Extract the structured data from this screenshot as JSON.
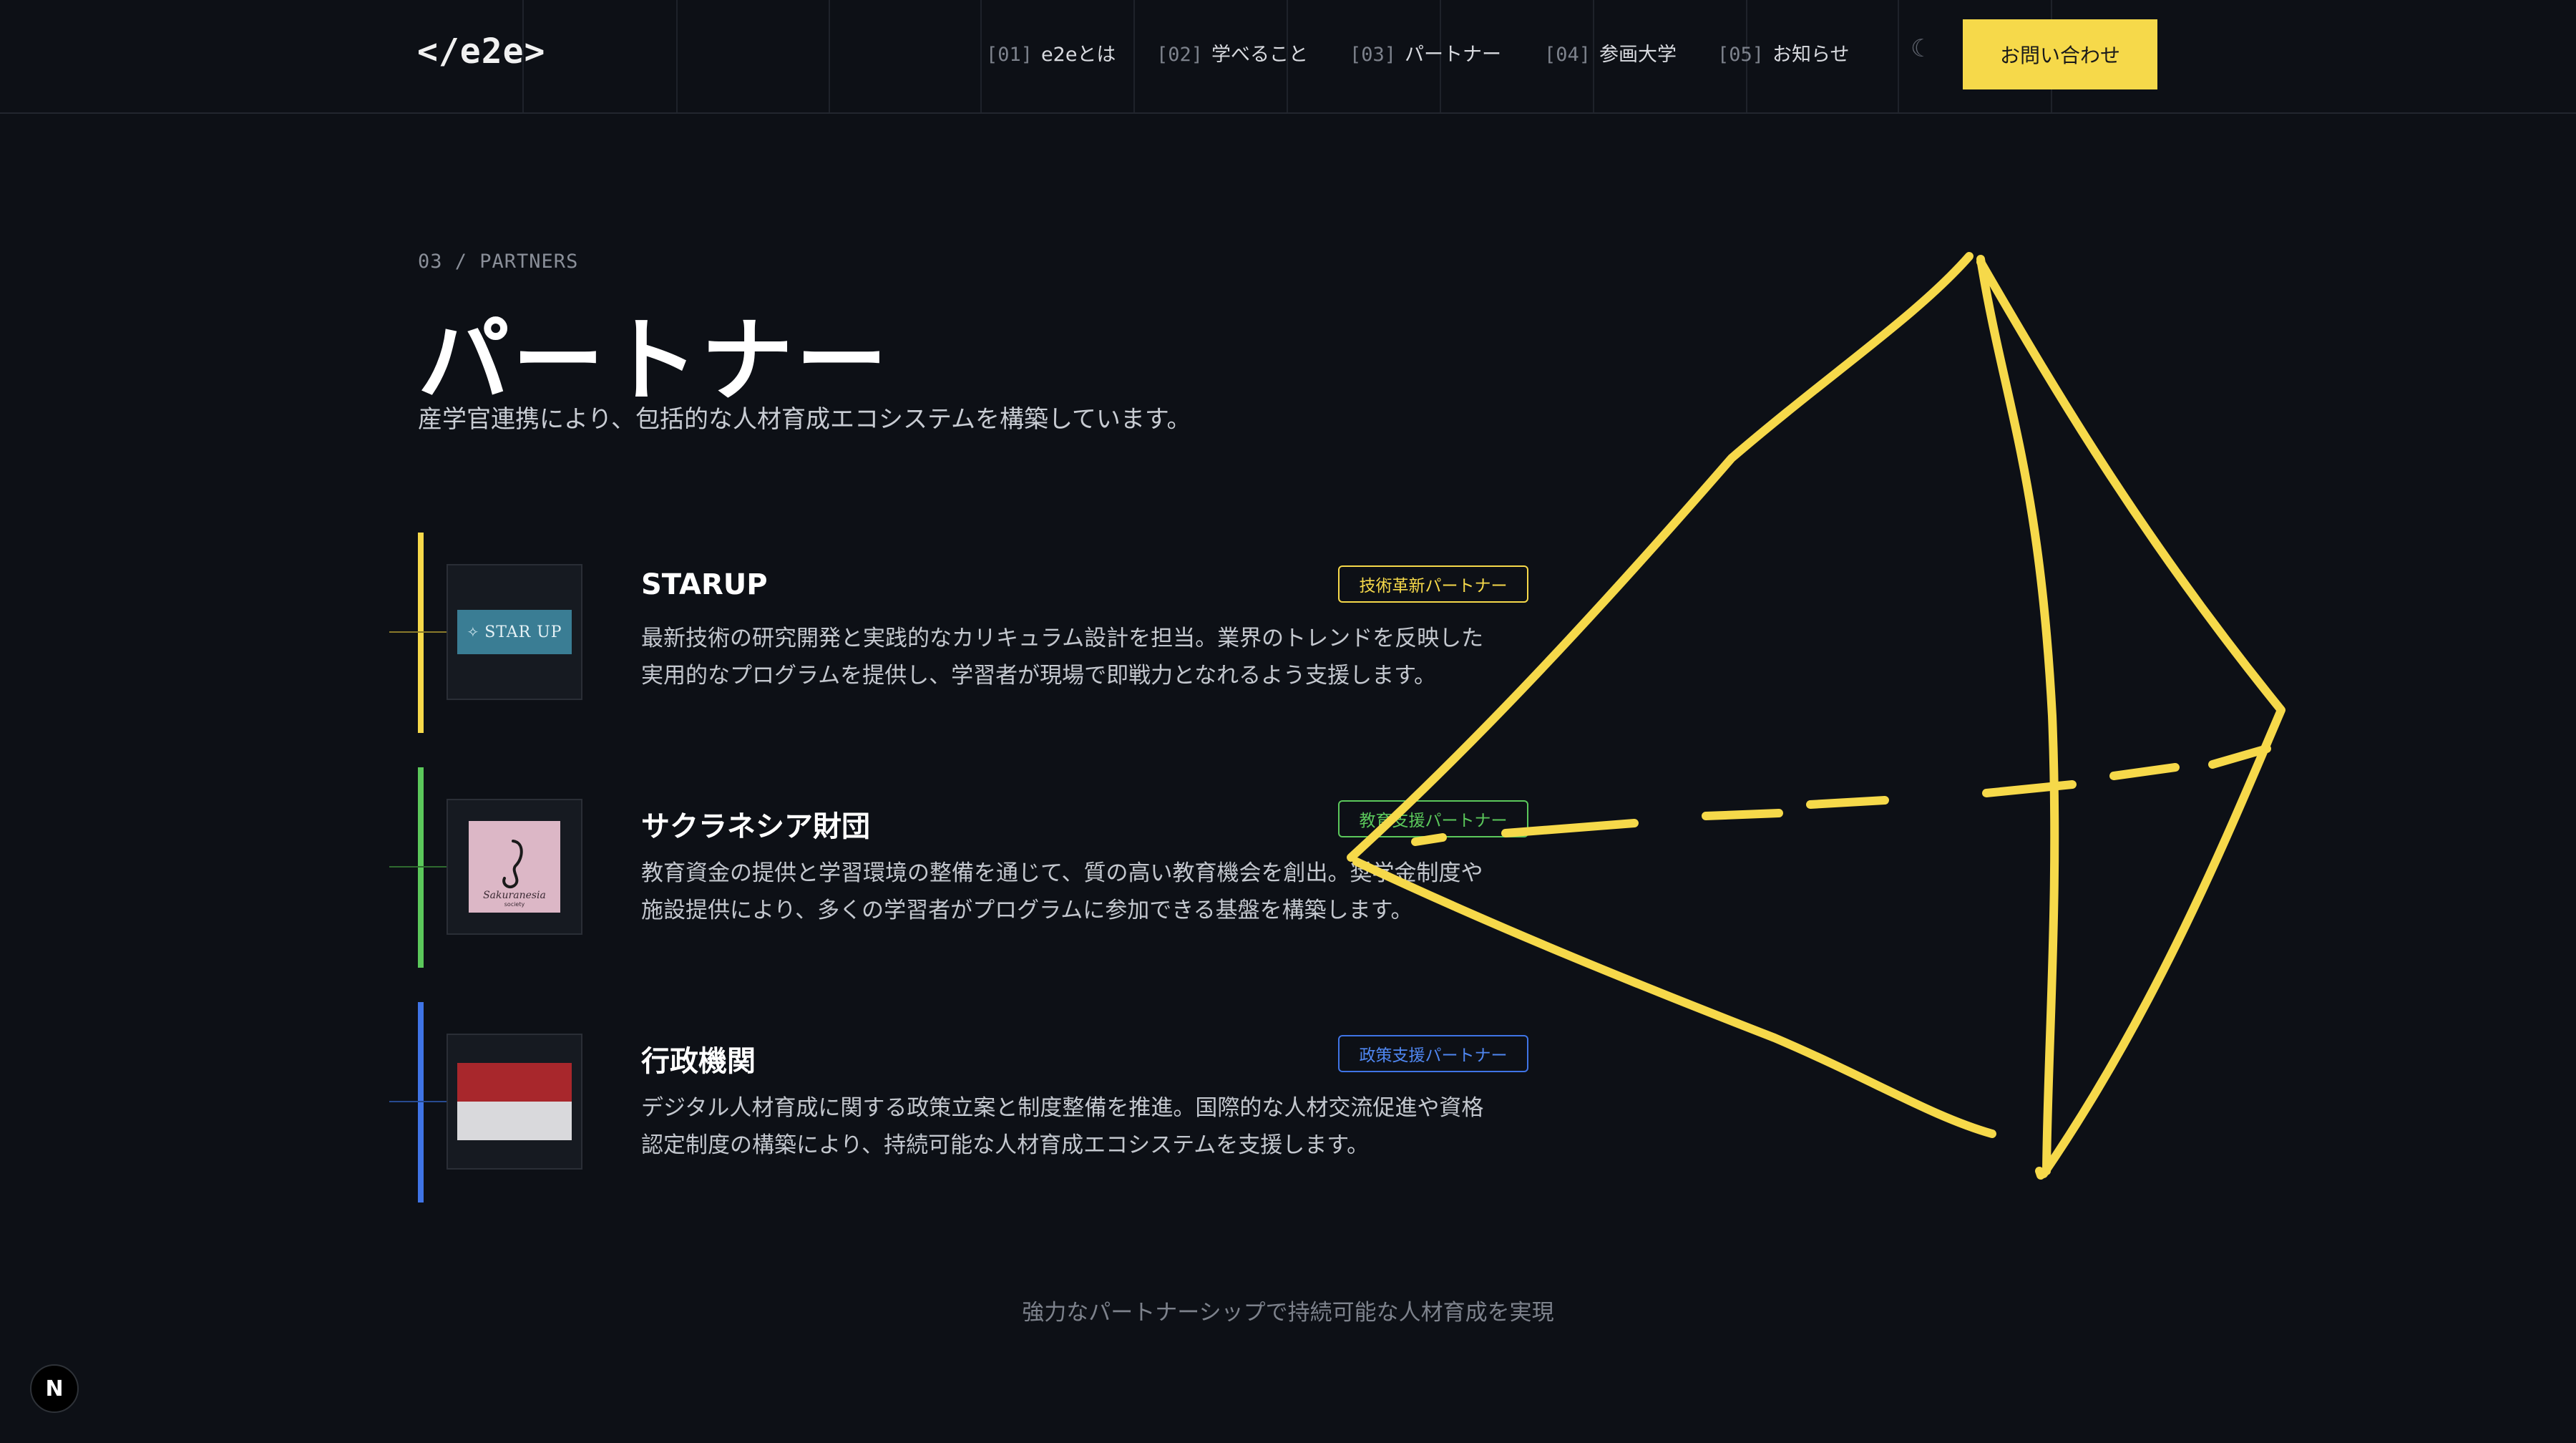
{
  "header": {
    "logo": {
      "open": "</",
      "slash_char": "",
      "name": "e2e>"
    },
    "nav": [
      {
        "num": "[01]",
        "label": "e2eとは"
      },
      {
        "num": "[02]",
        "label": "学べること"
      },
      {
        "num": "[03]",
        "label": "パートナー"
      },
      {
        "num": "[04]",
        "label": "参画大学"
      },
      {
        "num": "[05]",
        "label": "お知らせ"
      }
    ],
    "theme_toggle_icon": "moon-icon",
    "theme_toggle_glyph": "☾",
    "contact_label": "お問い合わせ"
  },
  "section": {
    "eyebrow": "03 / PARTNERS",
    "title": "パートナー",
    "subtitle": "産学官連携により、包括的な人材育成エコシステムを構築しています。"
  },
  "partners": [
    {
      "name": "STARUP",
      "tag": "技術革新パートナー",
      "description_line1": "最新技術の研究開発と実践的なカリキュラム設計を担当。業界のトレンドを反映した",
      "description_line2": "実用的なプログラムを提供し、学習者が現場で即戦力となれるよう支援します。",
      "logo_text": "STAR UP",
      "color": "#f6d94a"
    },
    {
      "name": "サクラネシア財団",
      "tag": "教育支援パートナー",
      "description_line1": "教育資金の提供と学習環境の整備を通じて、質の高い教育機会を創出。奨学金制度や",
      "description_line2": "施設提供により、多くの学習者がプログラムに参加できる基盤を構築します。",
      "logo_text": "Sakuranesia",
      "logo_subtext": "society",
      "color": "#5bc85b"
    },
    {
      "name": "行政機関",
      "tag": "政策支援パートナー",
      "description_line1": "デジタル人材育成に関する政策立案と制度整備を推進。国際的な人材交流促進や資格",
      "description_line2": "認定制度の構築により、持続可能な人材育成エコシステムを支援します。",
      "color": "#3f74e6"
    }
  ],
  "footer": {
    "tagline": "強力なパートナーシップで持続可能な人材育成を実現"
  },
  "dev_badge": {
    "letter": "N"
  },
  "colors": {
    "background": "#0d1016",
    "accent_yellow": "#f6d94a",
    "accent_green": "#5bc85b",
    "accent_blue": "#3f74e6",
    "flag_red": "#a8272c",
    "flag_white": "#d9d9dc"
  }
}
